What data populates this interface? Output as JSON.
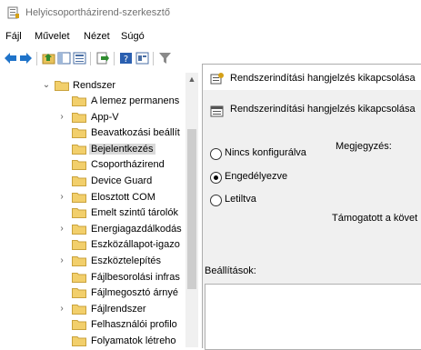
{
  "window": {
    "title": "Helyicsoportházirend-szerkesztő"
  },
  "menu": [
    "Fájl",
    "Művelet",
    "Nézet",
    "Súgó"
  ],
  "tree": {
    "root": "Rendszer",
    "items": [
      {
        "label": "A lemez permanens",
        "expandable": false
      },
      {
        "label": "App-V",
        "expandable": true
      },
      {
        "label": "Beavatkozási beállít",
        "expandable": false
      },
      {
        "label": "Bejelentkezés",
        "expandable": false,
        "selected": true
      },
      {
        "label": "Csoportházirend",
        "expandable": false
      },
      {
        "label": "Device Guard",
        "expandable": false
      },
      {
        "label": "Elosztott COM",
        "expandable": true
      },
      {
        "label": "Emelt szintű tárolók",
        "expandable": false
      },
      {
        "label": "Energiagazdálkodás",
        "expandable": true
      },
      {
        "label": "Eszközállapot-igazo",
        "expandable": false
      },
      {
        "label": "Eszköztelepítés",
        "expandable": true
      },
      {
        "label": "Fájlbesorolási infras",
        "expandable": false
      },
      {
        "label": "Fájlmegosztó árnyé",
        "expandable": false
      },
      {
        "label": "Fájlrendszer",
        "expandable": true
      },
      {
        "label": "Felhasználói profilo",
        "expandable": false
      },
      {
        "label": "Folyamatok létreho",
        "expandable": false
      }
    ]
  },
  "dialog": {
    "title": "Rendszerindítási hangjelzés kikapcsolása",
    "header": "Rendszerindítási hangjelzés kikapcsolása",
    "options": [
      {
        "label": "Nincs konfigurálva",
        "selected": false
      },
      {
        "label": "Engedélyezve",
        "selected": true
      },
      {
        "label": "Letiltva",
        "selected": false
      }
    ],
    "comment_label": "Megjegyzés:",
    "supported_label": "Támogatott a követ",
    "settings_label": "Beállítások:"
  }
}
